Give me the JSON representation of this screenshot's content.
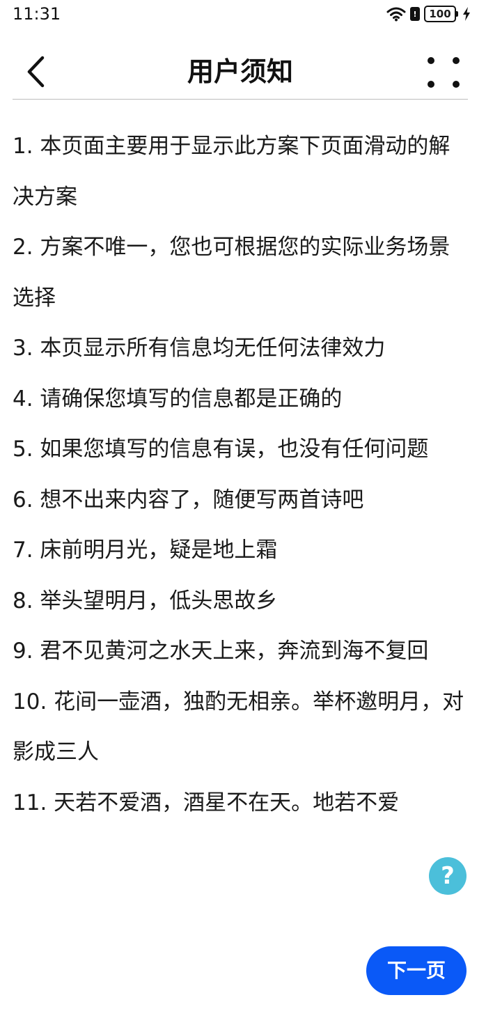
{
  "status_bar": {
    "time": "11:31",
    "sim_label": "!",
    "battery_level": "100",
    "icons": [
      "wifi-icon",
      "sim-alert-icon",
      "battery-icon",
      "charging-icon"
    ]
  },
  "header": {
    "title": "用户须知",
    "back_icon": "chevron-left-icon",
    "more_icon": "four-dots-icon"
  },
  "notices": [
    "1. 本页面主要用于显示此方案下页面滑动的解决方案",
    "2. 方案不唯一，您也可根据您的实际业务场景选择",
    "3. 本页显示所有信息均无任何法律效力",
    "4. 请确保您填写的信息都是正确的",
    "5. 如果您填写的信息有误，也没有任何问题",
    "6. 想不出来内容了，随便写两首诗吧",
    "7. 床前明月光，疑是地上霜",
    "8. 举头望明月，低头思故乡",
    "9. 君不见黄河之水天上来，奔流到海不复回",
    "10. 花间一壶酒，独酌无相亲。举杯邀明月，对影成三人",
    "11. 天若不爱酒，酒星不在天。地若不爱"
  ],
  "help_button": {
    "label": "?",
    "icon": "help-icon",
    "color": "#4bbfda"
  },
  "next_button": {
    "label": "下一页",
    "color": "#0a59f7"
  }
}
